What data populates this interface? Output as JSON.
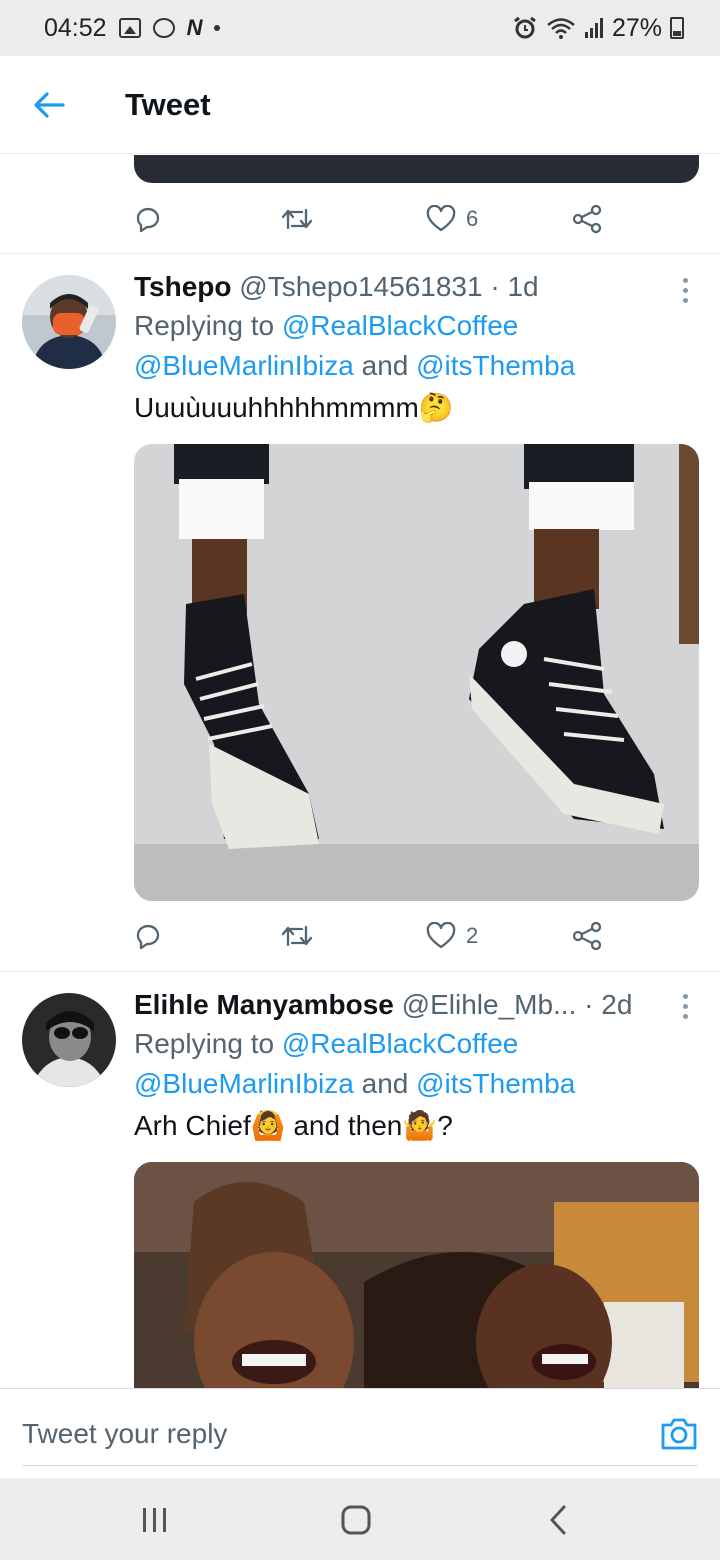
{
  "status_bar": {
    "time": "04:52",
    "battery": "27%"
  },
  "header": {
    "title": "Tweet"
  },
  "prev_tweet": {
    "likes": "6"
  },
  "tweets": [
    {
      "name": "Tshepo",
      "handle": "@Tshepo14561831",
      "time": "· 1d",
      "replying_prefix": "Replying to",
      "mention1": "@RealBlackCoffee",
      "mention2": "@BlueMarlinIbiza",
      "conj": "and",
      "mention3": "@itsThemba",
      "text": "Uuuùuuuhhhhhmmmm🤔",
      "likes": "2"
    },
    {
      "name": "Elihle Manyambose",
      "handle": "@Elihle_Mb...",
      "time": "· 2d",
      "replying_prefix": "Replying to",
      "mention1": "@RealBlackCoffee",
      "mention2": "@BlueMarlinIbiza",
      "conj": "and",
      "mention3": "@itsThemba",
      "text": "Arh Chief🙆 and then🤷?"
    }
  ],
  "reply": {
    "placeholder": "Tweet your reply"
  },
  "colors": {
    "accent": "#1d9bf0",
    "muted": "#536471",
    "text": "#0f1419"
  },
  "icons": [
    "back-arrow-icon",
    "reply-icon",
    "retweet-icon",
    "like-icon",
    "share-icon",
    "more-icon",
    "camera-icon",
    "recents-icon",
    "home-icon",
    "back-icon"
  ]
}
